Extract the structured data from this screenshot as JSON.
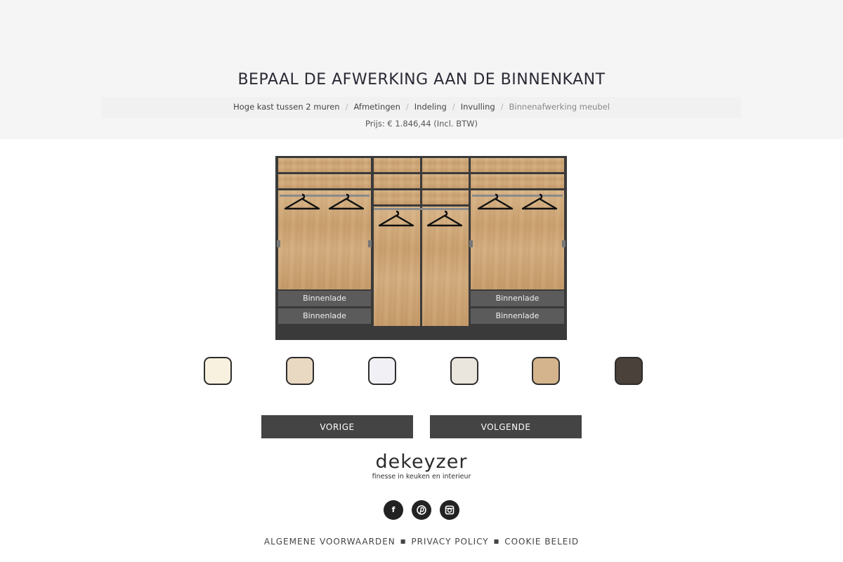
{
  "header": {
    "title": "BEPAAL DE AFWERKING AAN DE BINNENKANT",
    "breadcrumb": [
      {
        "label": "Hoge kast tussen 2 muren"
      },
      {
        "label": "Afmetingen"
      },
      {
        "label": "Indeling"
      },
      {
        "label": "Invulling"
      },
      {
        "label": "Binnenafwerking meubel"
      }
    ],
    "breadcrumb_separator": "/",
    "price": "Prijs: € 1.846,44 (Incl. BTW)"
  },
  "wardrobe": {
    "drawer_label": "Binnenlade",
    "drawers": [
      "Binnenlade",
      "Binnenlade",
      "Binnenlade",
      "Binnenlade"
    ]
  },
  "swatches": [
    {
      "name": "creme",
      "color": "#f8f1df"
    },
    {
      "name": "licht-eiken",
      "color": "#e9d8c2"
    },
    {
      "name": "wit",
      "color": "#f1f1f5"
    },
    {
      "name": "zilvergrijs",
      "color": "#ebe6dd"
    },
    {
      "name": "eiken",
      "color": "#d4b48c"
    },
    {
      "name": "donker-eiken",
      "color": "#4a413a"
    }
  ],
  "navigation": {
    "prev_label": "VORIGE",
    "next_label": "VOLGENDE"
  },
  "brand": {
    "name": "dekeyzer",
    "tagline": "finesse in keuken en interieur"
  },
  "social": [
    {
      "name": "facebook-icon",
      "glyph": "f"
    },
    {
      "name": "pinterest-icon",
      "glyph": "℗"
    },
    {
      "name": "instagram-icon",
      "glyph": "◙"
    }
  ],
  "footer": {
    "links": [
      "ALGEMENE VOORWAARDEN",
      "PRIVACY POLICY",
      "COOKIE BELEID"
    ],
    "separator": "■"
  }
}
